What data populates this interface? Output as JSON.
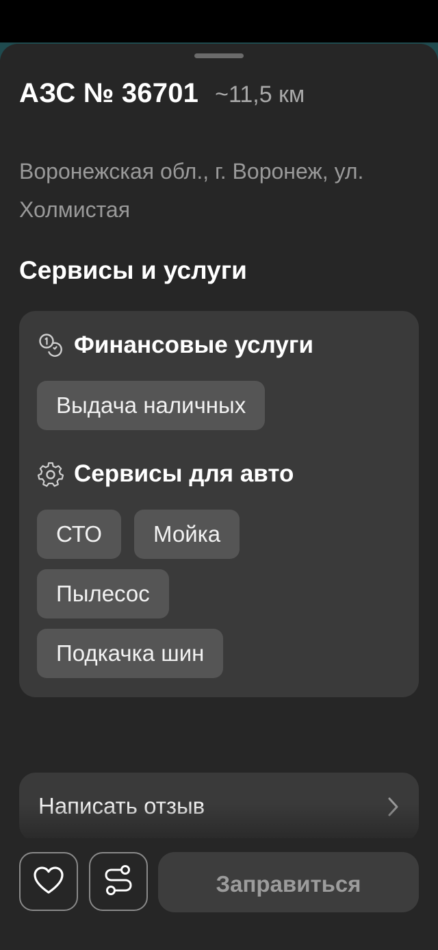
{
  "station": {
    "title": "АЗС № 36701",
    "distance": "~11,5 км",
    "address": "Воронежская обл., г. Воронеж, ул. Холмистая"
  },
  "services": {
    "heading": "Сервисы и услуги",
    "groups": [
      {
        "icon": "coins-icon",
        "title": "Финансовые услуги",
        "items": [
          "Выдача наличных"
        ]
      },
      {
        "icon": "gear-icon",
        "title": "Сервисы для авто",
        "items": [
          "СТО",
          "Мойка",
          "Пылесос",
          "Подкачка шин"
        ]
      }
    ]
  },
  "review": {
    "label": "Написать отзыв",
    "icon": "chevron-right-icon"
  },
  "actions": {
    "favorite_icon": "heart-icon",
    "route_icon": "route-icon",
    "primary_label": "Заправиться"
  },
  "colors": {
    "sheet_background": "#262626",
    "card_background": "#3a3a3a",
    "chip_background": "#555555",
    "map_tint": "#1f4a4e"
  }
}
